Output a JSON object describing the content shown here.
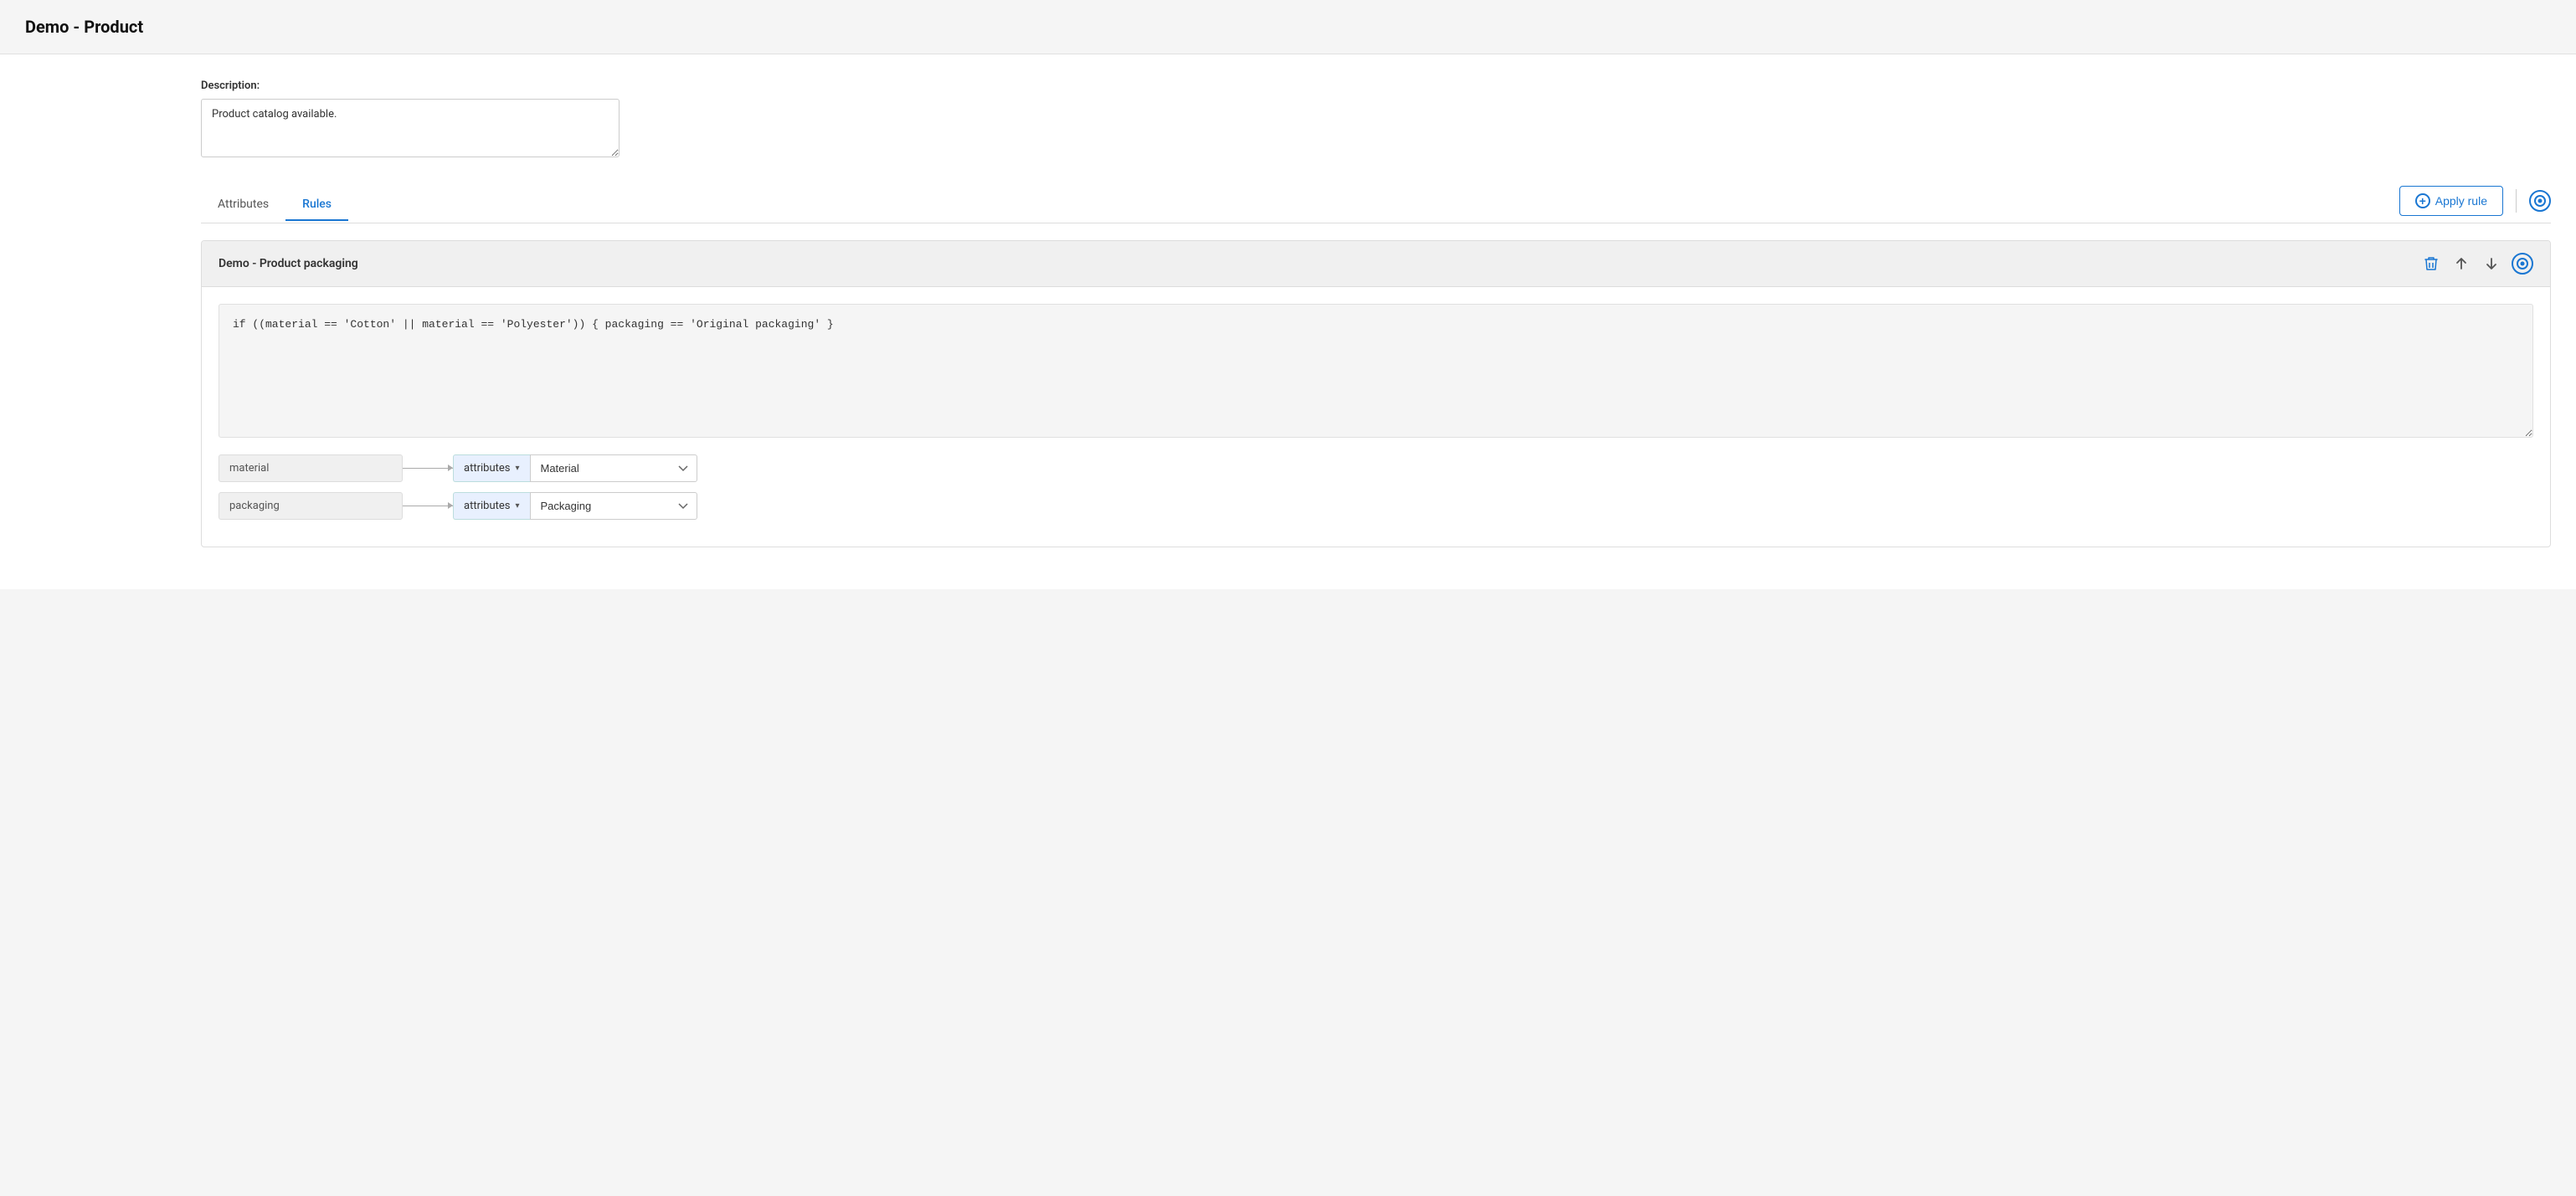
{
  "header": {
    "title": "Demo - Product"
  },
  "form": {
    "description_label": "Description:",
    "description_value": "Product catalog available."
  },
  "tabs": [
    {
      "id": "attributes",
      "label": "Attributes",
      "active": false
    },
    {
      "id": "rules",
      "label": "Rules",
      "active": true
    }
  ],
  "toolbar": {
    "apply_rule_label": "Apply rule",
    "apply_rule_icon": "⊕"
  },
  "rule_card": {
    "title": "Demo - Product packaging",
    "formula": "if ((material == 'Cotton' || material == 'Polyester')) { packaging == 'Original packaging' }",
    "variables": [
      {
        "name": "material",
        "type": "attributes",
        "value": "Material"
      },
      {
        "name": "packaging",
        "type": "attributes",
        "value": "Packaging"
      }
    ]
  },
  "icons": {
    "trash": "🗑",
    "arrow_up": "↑",
    "arrow_down": "↓",
    "circle_check": "◉",
    "chevron_down": "▾",
    "plus": "+"
  }
}
